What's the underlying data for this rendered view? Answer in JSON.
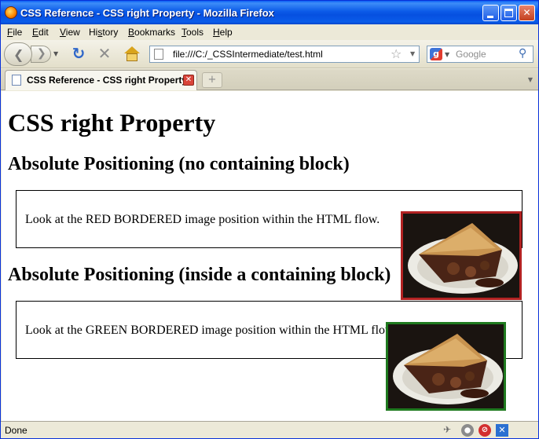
{
  "window": {
    "title": "CSS Reference - CSS right Property - Mozilla Firefox",
    "buttons": {
      "minimize": "minimize",
      "maximize": "maximize",
      "close": "✕"
    }
  },
  "menu": {
    "items": [
      {
        "label": "File",
        "accel": "F"
      },
      {
        "label": "Edit",
        "accel": "E"
      },
      {
        "label": "View",
        "accel": "V"
      },
      {
        "label": "History",
        "accel": "s"
      },
      {
        "label": "Bookmarks",
        "accel": "B"
      },
      {
        "label": "Tools",
        "accel": "T"
      },
      {
        "label": "Help",
        "accel": "H"
      }
    ]
  },
  "navbar": {
    "url": "file:///C:/_CSSIntermediate/test.html",
    "search_placeholder": "Google",
    "icons": [
      "back-icon",
      "forward-icon",
      "reload-icon",
      "stop-icon",
      "home-icon",
      "bookmark-star-icon",
      "search-icon"
    ]
  },
  "tabs": [
    {
      "label": "CSS Reference - CSS right Property",
      "active": true
    }
  ],
  "page": {
    "heading": "CSS right Property",
    "section1": {
      "heading": "Absolute Positioning (no containing block)",
      "text": "Look at the RED BORDERED image position within the HTML flow.",
      "border_color": "#b22222"
    },
    "section2": {
      "heading": "Absolute Positioning (inside a containing block)",
      "text": "Look at the GREEN BORDERED image position within the HTML flow.",
      "border_color": "#1f7a1f"
    }
  },
  "status": {
    "text": "Done"
  }
}
